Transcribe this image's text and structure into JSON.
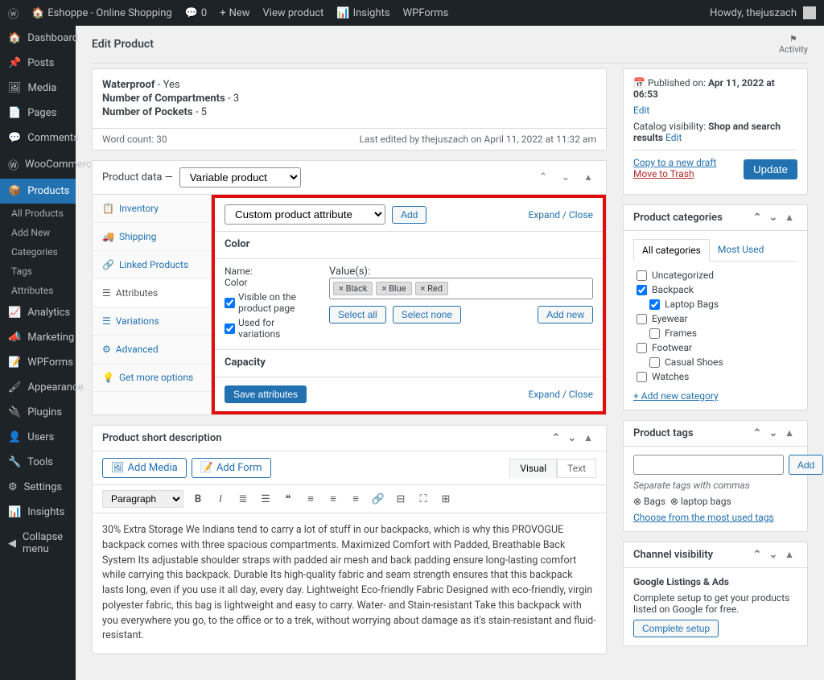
{
  "topbar": {
    "site": "Eshoppe - Online Shopping",
    "comments": "0",
    "new": "New",
    "view_product": "View product",
    "insights": "Insights",
    "wpforms": "WPForms",
    "greeting": "Howdy, thejuszach"
  },
  "sidebar": {
    "items": [
      {
        "label": "Dashboard",
        "icon": "dashboard-icon"
      },
      {
        "label": "Posts",
        "icon": "pin-icon"
      },
      {
        "label": "Media",
        "icon": "media-icon"
      },
      {
        "label": "Pages",
        "icon": "page-icon"
      },
      {
        "label": "Comments",
        "icon": "comment-icon"
      },
      {
        "label": "WooCommerce",
        "icon": "woo-icon"
      },
      {
        "label": "Products",
        "icon": "products-icon",
        "active": true
      },
      {
        "label": "Analytics",
        "icon": "analytics-icon"
      },
      {
        "label": "Marketing",
        "icon": "marketing-icon"
      },
      {
        "label": "WPForms",
        "icon": "wpforms-icon"
      },
      {
        "label": "Appearance",
        "icon": "appearance-icon"
      },
      {
        "label": "Plugins",
        "icon": "plugins-icon"
      },
      {
        "label": "Users",
        "icon": "users-icon"
      },
      {
        "label": "Tools",
        "icon": "tools-icon"
      },
      {
        "label": "Settings",
        "icon": "settings-icon"
      },
      {
        "label": "Insights",
        "icon": "insights-icon"
      },
      {
        "label": "Collapse menu",
        "icon": "collapse-icon"
      }
    ],
    "sub": [
      "All Products",
      "Add New",
      "Categories",
      "Tags",
      "Attributes"
    ]
  },
  "header": {
    "title": "Edit Product",
    "activity": "Activity"
  },
  "specs": [
    {
      "k": "Waterproof",
      "v": "Yes"
    },
    {
      "k": "Number of Compartments",
      "v": "3"
    },
    {
      "k": "Number of Pockets",
      "v": "5"
    }
  ],
  "wordcount": {
    "label": "Word count: 30",
    "lastedit": "Last edited by thejuszach on April 11, 2022 at 11:32 am"
  },
  "productdata": {
    "title": "Product data —",
    "type": "Variable product",
    "tabs": [
      "Inventory",
      "Shipping",
      "Linked Products",
      "Attributes",
      "Variations",
      "Advanced",
      "Get more options"
    ],
    "active_tab": 3,
    "attr_select": "Custom product attribute",
    "add": "Add",
    "expand": "Expand / Close",
    "color": {
      "title": "Color",
      "name_label": "Name:",
      "name_value": "Color",
      "values_label": "Value(s):",
      "tags": [
        "Black",
        "Blue",
        "Red"
      ],
      "visible": "Visible on the product page",
      "used": "Used for variations",
      "select_all": "Select all",
      "select_none": "Select none",
      "add_new": "Add new"
    },
    "capacity": {
      "title": "Capacity"
    },
    "save": "Save attributes"
  },
  "shortdesc": {
    "title": "Product short description",
    "add_media": "Add Media",
    "add_form": "Add Form",
    "visual": "Visual",
    "text": "Text",
    "paragraph": "Paragraph",
    "content": "30% Extra Storage We Indians tend to carry a lot of stuff in our backpacks, which is why this PROVOGUE backpack comes with three spacious compartments. Maximized Comfort with Padded, Breathable Back System Its adjustable shoulder straps with padded air mesh and back padding ensure long-lasting comfort while carrying this backpack. Durable Its high-quality fabric and seam strength ensures that this backpack lasts long, even if you use it all day, every day. Lightweight Eco-friendly Fabric Designed with eco-friendly, virgin polyester fabric, this bag is lightweight and easy to carry. Water- and Stain-resistant Take this backpack with you everywhere you go, to the office or to a trek, without worrying about damage as it's stain-resistant and fluid-resistant."
  },
  "publish": {
    "pub_label": "Published on:",
    "pub_date": "Apr 11, 2022 at 06:53",
    "edit": "Edit",
    "visibility_label": "Catalog visibility:",
    "visibility": "Shop and search results",
    "copy": "Copy to a new draft",
    "trash": "Move to Trash",
    "update": "Update"
  },
  "categories": {
    "title": "Product categories",
    "tabs": [
      "All categories",
      "Most Used"
    ],
    "items": [
      {
        "label": "Uncategorized",
        "checked": false,
        "indent": 0
      },
      {
        "label": "Backpack",
        "checked": true,
        "indent": 0
      },
      {
        "label": "Laptop Bags",
        "checked": true,
        "indent": 1
      },
      {
        "label": "Eyewear",
        "checked": false,
        "indent": 0
      },
      {
        "label": "Frames",
        "checked": false,
        "indent": 1
      },
      {
        "label": "Footwear",
        "checked": false,
        "indent": 0
      },
      {
        "label": "Casual Shoes",
        "checked": false,
        "indent": 1
      },
      {
        "label": "Watches",
        "checked": false,
        "indent": 0
      }
    ],
    "add_new": "+ Add new category"
  },
  "tags": {
    "title": "Product tags",
    "add": "Add",
    "hint": "Separate tags with commas",
    "applied": [
      "Bags",
      "laptop bags"
    ],
    "choose": "Choose from the most used tags"
  },
  "channel": {
    "title": "Channel visibility",
    "gla": "Google Listings & Ads",
    "desc": "Complete setup to get your products listed on Google for free.",
    "btn": "Complete setup"
  }
}
